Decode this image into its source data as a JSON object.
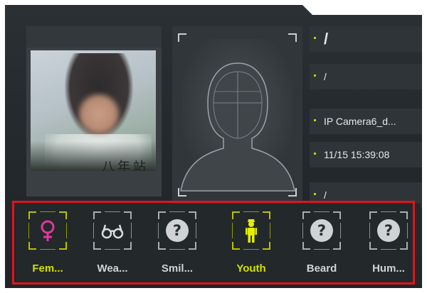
{
  "capture": {
    "sign_text": "八年站"
  },
  "info": {
    "rows": [
      {
        "text": "/"
      },
      {
        "text": "/"
      },
      {
        "text": "IP Camera6_d..."
      },
      {
        "text": "11/15 15:39:08"
      },
      {
        "text": "/"
      }
    ]
  },
  "attributes": [
    {
      "label": "Fem...",
      "icon": "female-icon",
      "active": true
    },
    {
      "label": "Wea...",
      "icon": "glasses-icon",
      "active": false
    },
    {
      "label": "Smil...",
      "icon": "question-icon",
      "active": false
    },
    {
      "label": "Youth",
      "icon": "youth-person-icon",
      "active": true
    },
    {
      "label": "Beard",
      "icon": "question-icon",
      "active": false
    },
    {
      "label": "Hum...",
      "icon": "question-icon",
      "active": false
    }
  ],
  "colors": {
    "accent": "#d2e100",
    "highlight": "#e0141b",
    "panel": "#2b3034"
  }
}
